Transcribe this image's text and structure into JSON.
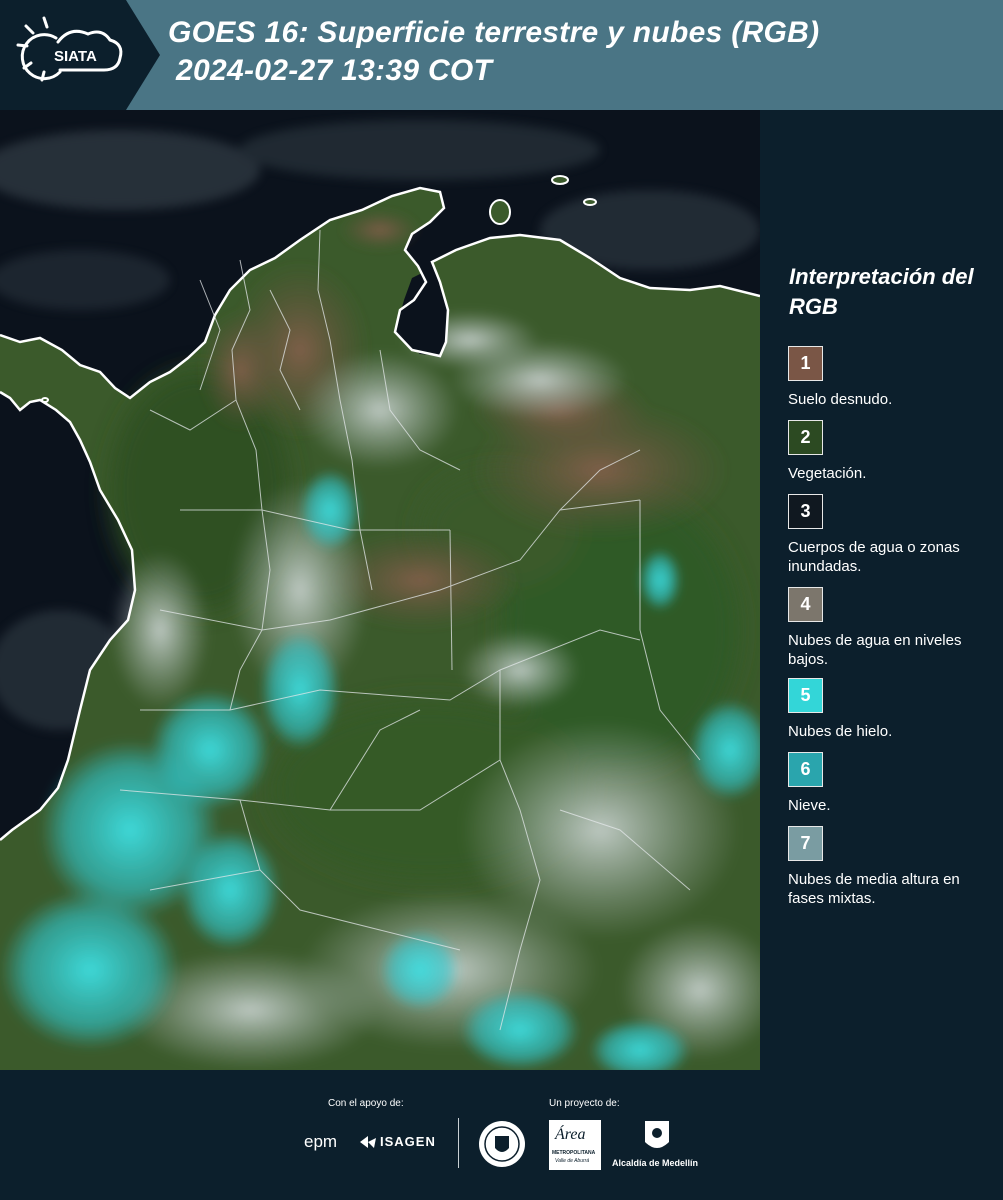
{
  "header": {
    "logo_text": "SIATA",
    "title_line1": "GOES 16: Superficie terrestre y nubes (RGB)",
    "title_line2": "2024-02-27 13:39 COT"
  },
  "legend": {
    "title": "Interpretación del RGB",
    "items": [
      {
        "number": "1",
        "label": "Suelo desnudo.",
        "color": "#7a5646"
      },
      {
        "number": "2",
        "label": "Vegetación.",
        "color": "#2c4a22"
      },
      {
        "number": "3",
        "label": "Cuerpos de agua o zonas inundadas.",
        "color": "#101820"
      },
      {
        "number": "4",
        "label": "Nubes de agua en niveles bajos.",
        "color": "#7c766c"
      },
      {
        "number": "5",
        "label": "Nubes de hielo.",
        "color": "#33d6d8"
      },
      {
        "number": "6",
        "label": "Nieve.",
        "color": "#2aa5ad"
      },
      {
        "number": "7",
        "label": "Nubes de media altura en fases mixtas.",
        "color": "#7a9ca2"
      }
    ]
  },
  "footer": {
    "support_label": "Con el apoyo de:",
    "project_label": "Un proyecto de:",
    "epm": "epm",
    "isagen": "ISAGEN",
    "area_name": "Área",
    "area_sub1": "METROPOLITANA",
    "area_sub2": "Valle de Aburrá",
    "alcaldia": "Alcaldía de Medellín"
  },
  "colors": {
    "header_bg": "#4a7585",
    "panel_bg": "#0c1f2c",
    "ocean": "#0b121c",
    "land": "#3c5b2c",
    "bare_soil": "#7a5646",
    "ice_cloud": "#33d6d8",
    "low_cloud": "#c5ced0"
  }
}
